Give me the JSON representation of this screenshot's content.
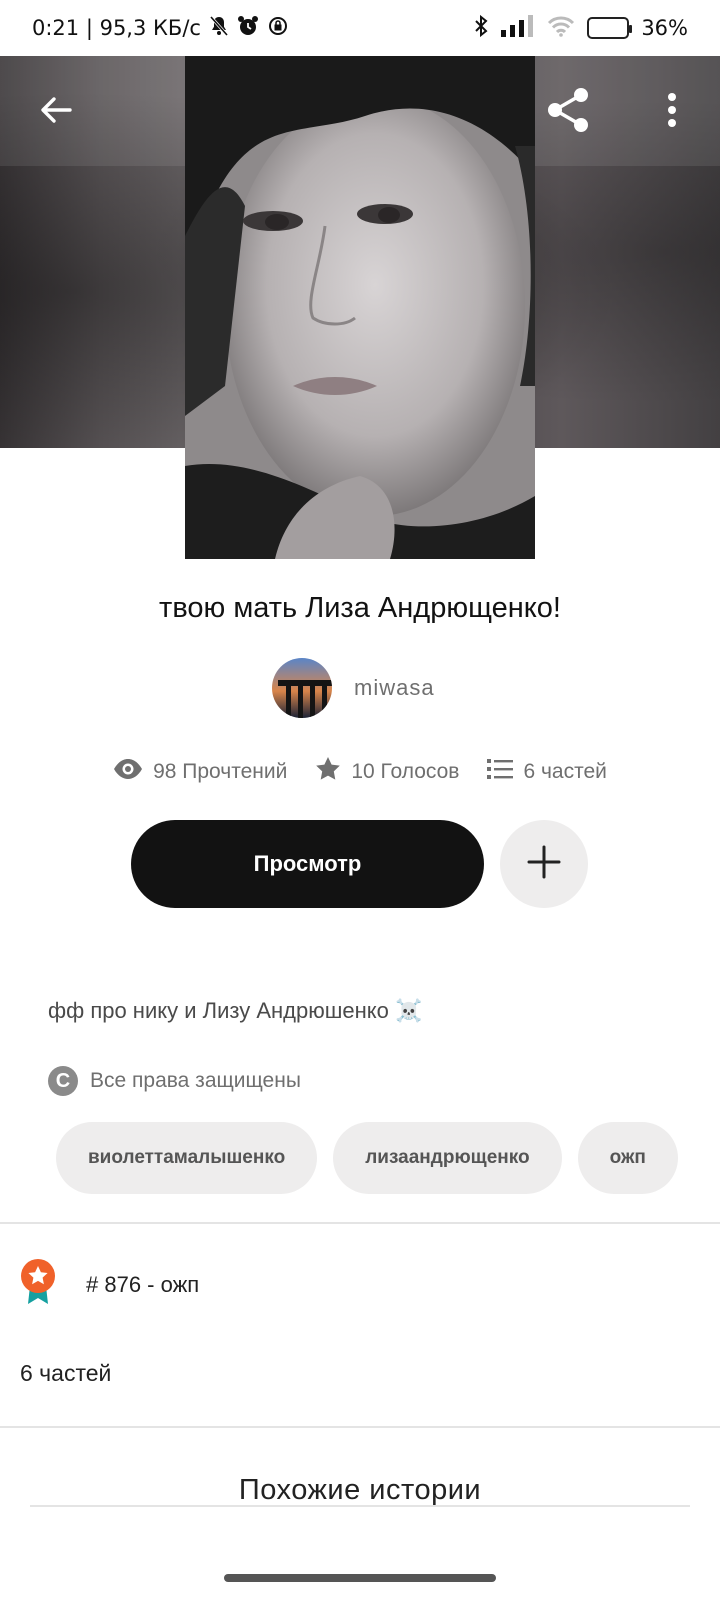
{
  "status_bar": {
    "time_speed": "0:21 | 95,3 КБ/с",
    "battery_percent": "36%",
    "battery_level": 0.36,
    "battery_color": "#f5c400",
    "icons": [
      "bell-muted-icon",
      "alarm-icon",
      "vpn-icon",
      "bluetooth-icon",
      "cellular-signal-icon",
      "wifi-icon",
      "battery-icon"
    ]
  },
  "header": {
    "back_icon": "arrow-left-icon",
    "share_icon": "share-icon",
    "more_icon": "more-vertical-icon"
  },
  "story": {
    "title": "твою мать Лиза Андрющенко!",
    "author": "miwasa",
    "stats": {
      "reads": "98 Прочтений",
      "votes": "10 Голосов",
      "parts": "6 частей"
    },
    "read_button": "Просмотр",
    "description": "фф про нику и Лизу Андрюшенко ☠️",
    "copyright": "Все права защищены",
    "tags": [
      "виолеттамалышенко",
      "лизаандрющенко",
      "ожп"
    ],
    "ranking": "# 876 - ожп",
    "parts_label": "6 частей"
  },
  "similar": {
    "title": "Похожие истории"
  },
  "colors": {
    "primary_button": "#121212",
    "secondary_button": "#eeeded",
    "badge_orange": "#f0612a",
    "badge_ribbon": "#15a0a0"
  }
}
